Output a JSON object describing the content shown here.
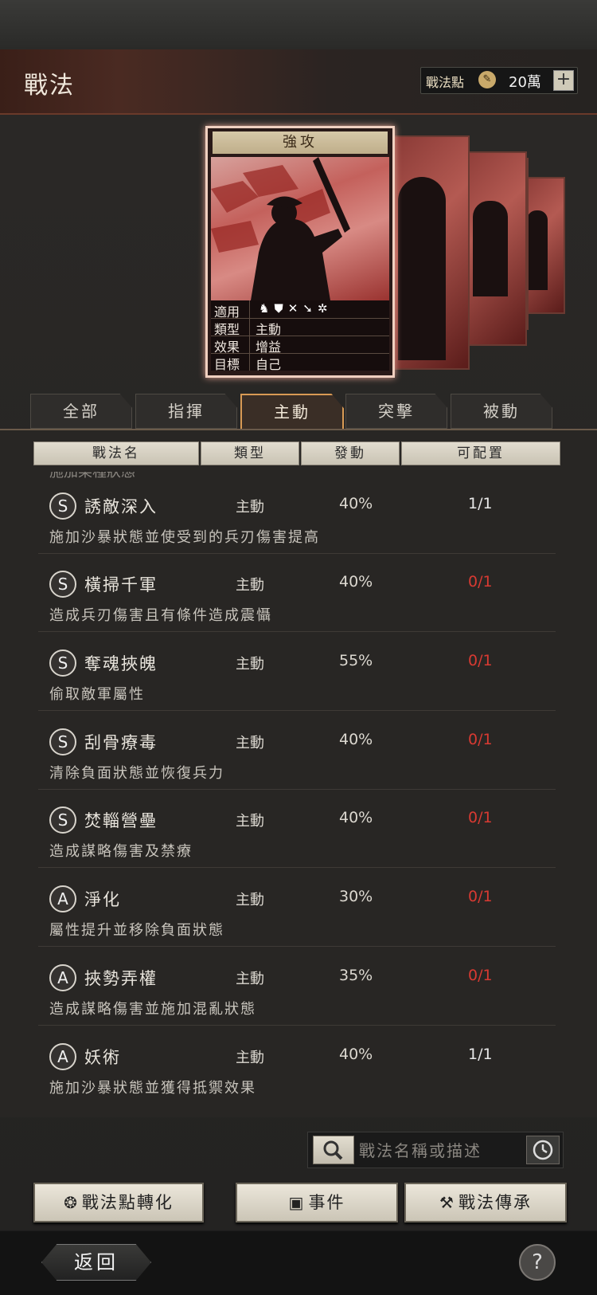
{
  "header": {
    "title": "戰法",
    "points_label": "戰法點",
    "points_value": "20萬",
    "plus": "+"
  },
  "card": {
    "title": "強攻",
    "info": [
      {
        "key": "適用",
        "value": ""
      },
      {
        "key": "類型",
        "value": "主動"
      },
      {
        "key": "效果",
        "value": "增益"
      },
      {
        "key": "目標",
        "value": "自己"
      }
    ],
    "applicable_icons": [
      "cavalry-icon",
      "shield-icon",
      "bow-icon",
      "spear-icon",
      "wheel-icon"
    ]
  },
  "tabs": [
    {
      "label": "全部",
      "active": false
    },
    {
      "label": "指揮",
      "active": false
    },
    {
      "label": "主動",
      "active": true
    },
    {
      "label": "突擊",
      "active": false
    },
    {
      "label": "被動",
      "active": false
    }
  ],
  "columns": [
    "戰法名",
    "類型",
    "發動",
    "可配置"
  ],
  "partial_row_text": "施加某種狀態",
  "rows": [
    {
      "grade": "S",
      "name": "誘敵深入",
      "type": "主動",
      "rate": "40%",
      "slot": "1/1",
      "slot_red": false,
      "desc": "施加沙暴狀態並使受到的兵刃傷害提高"
    },
    {
      "grade": "S",
      "name": "橫掃千軍",
      "type": "主動",
      "rate": "40%",
      "slot": "0/1",
      "slot_red": true,
      "desc": "造成兵刃傷害且有條件造成震懾"
    },
    {
      "grade": "S",
      "name": "奪魂挾魄",
      "type": "主動",
      "rate": "55%",
      "slot": "0/1",
      "slot_red": true,
      "desc": "偷取敵軍屬性"
    },
    {
      "grade": "S",
      "name": "刮骨療毒",
      "type": "主動",
      "rate": "40%",
      "slot": "0/1",
      "slot_red": true,
      "desc": "清除負面狀態並恢復兵力"
    },
    {
      "grade": "S",
      "name": "焚輜營壘",
      "type": "主動",
      "rate": "40%",
      "slot": "0/1",
      "slot_red": true,
      "desc": "造成謀略傷害及禁療"
    },
    {
      "grade": "A",
      "name": "淨化",
      "type": "主動",
      "rate": "30%",
      "slot": "0/1",
      "slot_red": true,
      "desc": "屬性提升並移除負面狀態"
    },
    {
      "grade": "A",
      "name": "挾勢弄權",
      "type": "主動",
      "rate": "35%",
      "slot": "0/1",
      "slot_red": true,
      "desc": "造成謀略傷害並施加混亂狀態"
    },
    {
      "grade": "A",
      "name": "妖術",
      "type": "主動",
      "rate": "40%",
      "slot": "1/1",
      "slot_red": false,
      "desc": "施加沙暴狀態並獲得抵禦效果"
    }
  ],
  "search": {
    "placeholder": "戰法名稱或描述"
  },
  "buttons": {
    "convert": "戰法點轉化",
    "events": "事件",
    "inherit": "戰法傳承"
  },
  "footer": {
    "back": "返回",
    "help": "?"
  },
  "colors": {
    "accent": "#d89a54",
    "red": "#d83a32",
    "card_border": "#f0d0c0"
  }
}
